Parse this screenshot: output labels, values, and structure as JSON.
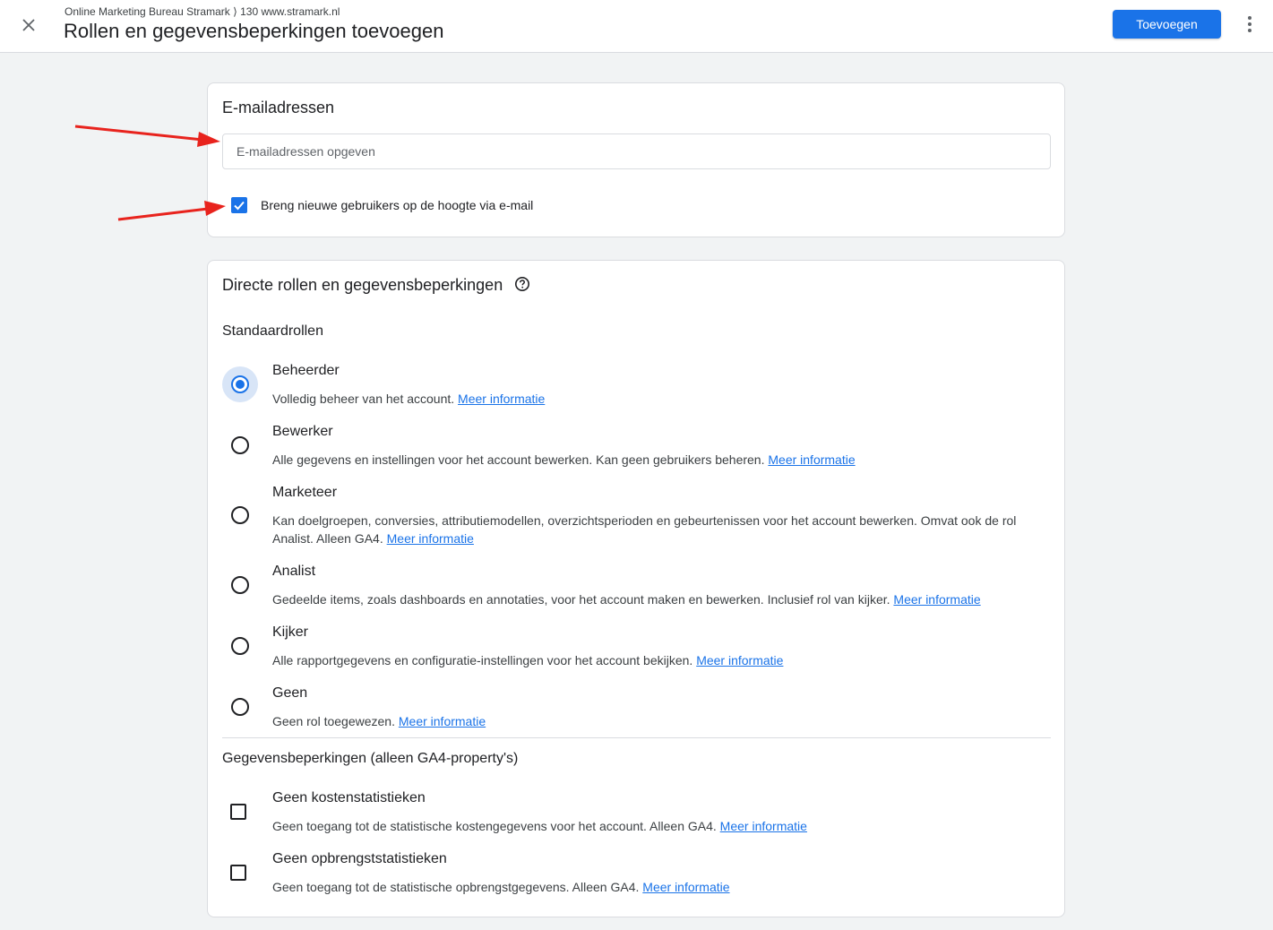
{
  "header": {
    "breadcrumb": "Online Marketing Bureau Stramark ⟩ 130 www.stramark.nl",
    "title": "Rollen en gegevensbeperkingen toevoegen",
    "add_label": "Toevoegen",
    "close_icon": "close-icon",
    "more_icon": "more-vert-icon"
  },
  "email_card": {
    "title": "E-mailadressen",
    "input_placeholder": "E-mailadressen opgeven",
    "input_value": "",
    "notify_label": "Breng nieuwe gebruikers op de hoogte via e-mail",
    "notify_checked": true
  },
  "roles_card": {
    "title": "Directe rollen en gegevensbeperkingen",
    "standard_roles_label": "Standaardrollen",
    "selected_role": "Beheerder",
    "roles": [
      {
        "name": "Beheerder",
        "desc": "Volledig beheer van het account.",
        "link": "Meer informatie"
      },
      {
        "name": "Bewerker",
        "desc": "Alle gegevens en instellingen voor het account bewerken. Kan geen gebruikers beheren.",
        "link": "Meer informatie"
      },
      {
        "name": "Marketeer",
        "desc": "Kan doelgroepen, conversies, attributiemodellen, overzichtsperioden en gebeurtenissen voor het account bewerken. Omvat ook de rol Analist. Alleen GA4.",
        "link": "Meer informatie"
      },
      {
        "name": "Analist",
        "desc": "Gedeelde items, zoals dashboards en annotaties, voor het account maken en bewerken. Inclusief rol van kijker.",
        "link": "Meer informatie"
      },
      {
        "name": "Kijker",
        "desc": "Alle rapportgegevens en configuratie-instellingen voor het account bekijken.",
        "link": "Meer informatie"
      },
      {
        "name": "Geen",
        "desc": "Geen rol toegewezen.",
        "link": "Meer informatie"
      }
    ],
    "restrictions_label": "Gegevensbeperkingen (alleen GA4-property's)",
    "restrictions": [
      {
        "name": "Geen kostenstatistieken",
        "desc": "Geen toegang tot de statistische kostengegevens voor het account. Alleen GA4.",
        "link": "Meer informatie",
        "checked": false
      },
      {
        "name": "Geen opbrengststatistieken",
        "desc": "Geen toegang tot de statistische opbrengstgegevens. Alleen GA4.",
        "link": "Meer informatie",
        "checked": false
      }
    ]
  },
  "colors": {
    "accent": "#1a73e8",
    "annotation_arrow": "#e8231d",
    "background": "#f1f3f4"
  }
}
